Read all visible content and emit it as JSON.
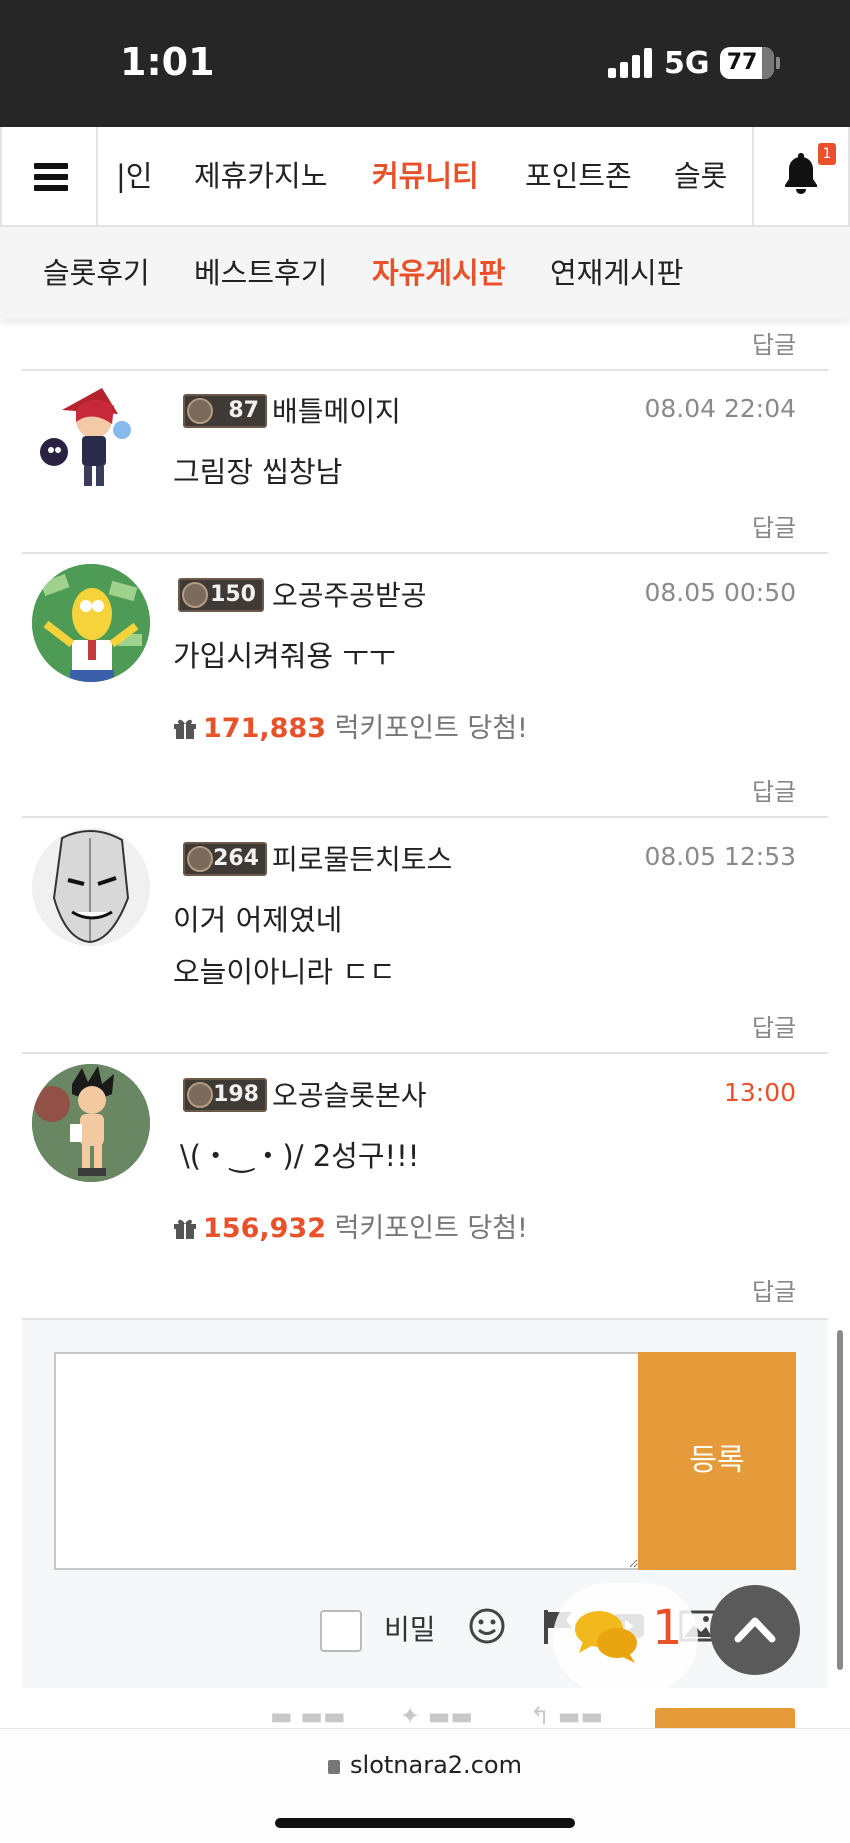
{
  "status_bar": {
    "time": "1:01",
    "network": "5G",
    "battery": "77"
  },
  "main_nav": {
    "items": [
      "|인",
      "제휴카지노",
      "커뮤니티",
      "포인트존",
      "슬롯"
    ],
    "active": "커뮤니티",
    "notification_count": "1"
  },
  "sub_nav": {
    "items": [
      "슬롯후기",
      "베스트후기",
      "자유게시판",
      "연재게시판"
    ],
    "active": "자유게시판"
  },
  "reply_label": "답글",
  "comments": [
    {
      "level": "87",
      "nickname": "배틀메이지",
      "time": "08.04 22:04",
      "lines": [
        "그림장 씹창남"
      ],
      "prize": null
    },
    {
      "level": "150",
      "nickname": "오공주공받공",
      "time": "08.05 00:50",
      "lines": [
        "가입시켜줘용 ㅜㅜ"
      ],
      "prize": {
        "points": "171,883",
        "suffix": "럭키포인트 당첨!"
      }
    },
    {
      "level": "264",
      "nickname": "피로물든치토스",
      "time": "08.05 12:53",
      "lines": [
        "이거 어제였네",
        "오늘이아니라 ㄷㄷ"
      ],
      "prize": null
    },
    {
      "level": "198",
      "nickname": "오공슬롯본사",
      "time": "13:00",
      "time_is_today": true,
      "lines": [
        "\\(・‿・)/ 2성구!!!"
      ],
      "prize": {
        "points": "156,932",
        "suffix": "럭키포인트 당첨!"
      }
    }
  ],
  "write_form": {
    "submit_label": "등록",
    "secret_label": "비밀"
  },
  "chat": {
    "count": "1"
  },
  "browser": {
    "url": "slotnara2.com"
  },
  "colors": {
    "accent": "#e8512a",
    "submit": "#e69b3a",
    "status_bar": "#262626"
  }
}
